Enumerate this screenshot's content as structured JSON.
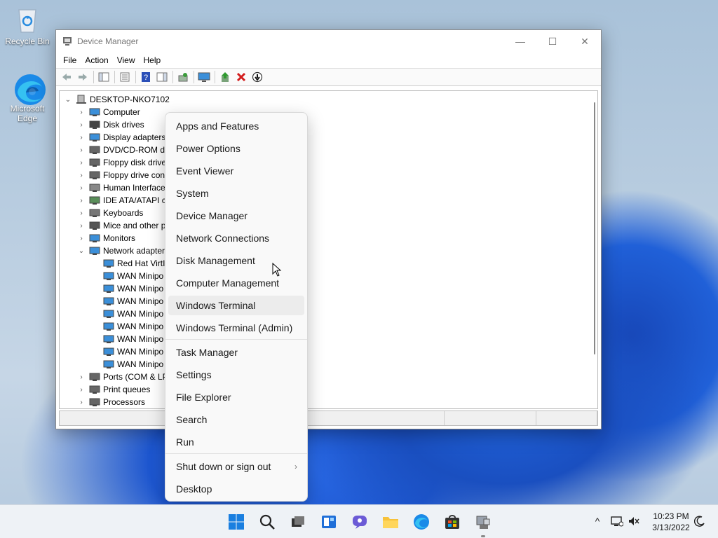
{
  "desktop": {
    "icons": [
      {
        "label": "Recycle Bin"
      },
      {
        "label": "Microsoft Edge"
      }
    ]
  },
  "window": {
    "title": "Device Manager",
    "controls": {
      "minimize": "—",
      "maximize": "☐",
      "close": "✕"
    },
    "menu": [
      "File",
      "Action",
      "View",
      "Help"
    ],
    "tree": {
      "root": "DESKTOP-NKO7102",
      "items": [
        {
          "label": "Computer",
          "expanded": false,
          "level": 1
        },
        {
          "label": "Disk drives",
          "expanded": false,
          "level": 1
        },
        {
          "label": "Display adapters",
          "expanded": false,
          "level": 1
        },
        {
          "label": "DVD/CD-ROM dr",
          "expanded": false,
          "level": 1
        },
        {
          "label": "Floppy disk drive",
          "expanded": false,
          "level": 1
        },
        {
          "label": "Floppy drive con",
          "expanded": false,
          "level": 1
        },
        {
          "label": "Human Interface",
          "expanded": false,
          "level": 1
        },
        {
          "label": "IDE ATA/ATAPI co",
          "expanded": false,
          "level": 1
        },
        {
          "label": "Keyboards",
          "expanded": false,
          "level": 1
        },
        {
          "label": "Mice and other p",
          "expanded": false,
          "level": 1
        },
        {
          "label": "Monitors",
          "expanded": false,
          "level": 1
        },
        {
          "label": "Network adapter",
          "expanded": true,
          "level": 1
        },
        {
          "label": "Red Hat VirtIO",
          "level": 2
        },
        {
          "label": "WAN Minipo",
          "level": 2
        },
        {
          "label": "WAN Minipo",
          "level": 2
        },
        {
          "label": "WAN Minipo",
          "level": 2
        },
        {
          "label": "WAN Minipo",
          "level": 2
        },
        {
          "label": "WAN Minipo",
          "level": 2
        },
        {
          "label": "WAN Minipo",
          "level": 2
        },
        {
          "label": "WAN Minipo",
          "level": 2
        },
        {
          "label": "WAN Minipo",
          "level": 2
        },
        {
          "label": "Ports (COM & LP",
          "expanded": false,
          "level": 1
        },
        {
          "label": "Print queues",
          "expanded": false,
          "level": 1
        },
        {
          "label": "Processors",
          "expanded": false,
          "level": 1
        }
      ]
    }
  },
  "context_menu": {
    "items": [
      {
        "label": "Apps and Features"
      },
      {
        "label": "Power Options"
      },
      {
        "label": "Event Viewer"
      },
      {
        "label": "System"
      },
      {
        "label": "Device Manager"
      },
      {
        "label": "Network Connections"
      },
      {
        "label": "Disk Management"
      },
      {
        "label": "Computer Management"
      },
      {
        "label": "Windows Terminal",
        "hovered": true
      },
      {
        "label": "Windows Terminal (Admin)"
      },
      {
        "label": "Task Manager"
      },
      {
        "label": "Settings"
      },
      {
        "label": "File Explorer"
      },
      {
        "label": "Search"
      },
      {
        "label": "Run"
      },
      {
        "label": "Shut down or sign out",
        "submenu": true
      },
      {
        "label": "Desktop"
      }
    ],
    "submenu_arrow": "›"
  },
  "taskbar": {
    "apps": [
      "start-icon",
      "search-icon",
      "task-view-icon",
      "widgets-icon",
      "chat-icon",
      "file-explorer-icon",
      "edge-icon",
      "store-icon",
      "device-manager-icon"
    ],
    "tray": {
      "chevron": "^"
    },
    "clock": {
      "time": "10:23 PM",
      "date": "3/13/2022"
    }
  },
  "colors": {
    "accent": "#0067c0",
    "window_bg": "#ffffff",
    "menu_bg": "#f9f9f9",
    "taskbar_bg": "#eef2f6"
  }
}
